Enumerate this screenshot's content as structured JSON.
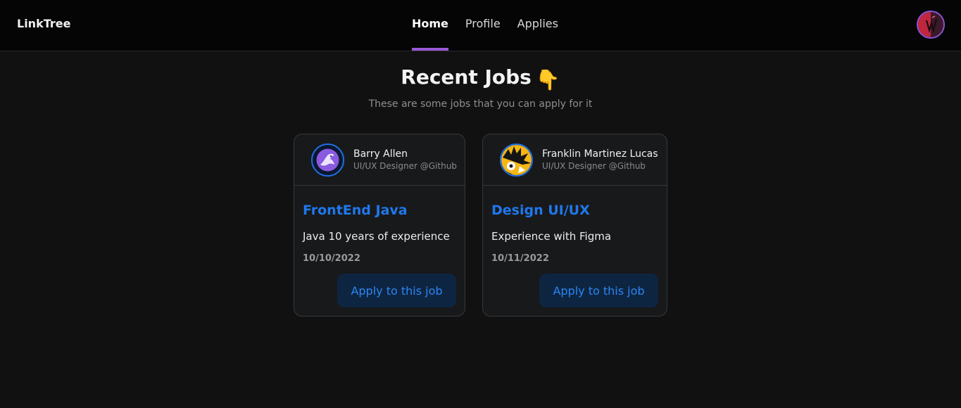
{
  "nav": {
    "brand": "LinkTree",
    "links": [
      {
        "label": "Home",
        "active": true
      },
      {
        "label": "Profile",
        "active": false
      },
      {
        "label": "Applies",
        "active": false
      }
    ]
  },
  "main": {
    "title": "Recent Jobs",
    "title_emoji": "👇",
    "subtitle": "These are some jobs that you can apply for it"
  },
  "jobs": [
    {
      "author_name": "Barry Allen",
      "author_role": "UI/UX Designer @Github",
      "title": "FrontEnd Java",
      "description": "Java 10 years of experience",
      "date": "10/10/2022",
      "apply_label": "Apply to this job",
      "avatar_icon": "purple-dragon-avatar"
    },
    {
      "author_name": "Franklin Martinez Lucas",
      "author_role": "UI/UX Designer @Github",
      "title": "Design UI/UX",
      "description": "Experience with Figma",
      "date": "10/11/2022",
      "apply_label": "Apply to this job",
      "avatar_icon": "yellow-cartoon-avatar"
    }
  ],
  "colors": {
    "accent_purple": "#9b57d6",
    "link_blue": "#1f78ec",
    "button_bg": "#0e2542",
    "background": "#111112"
  }
}
